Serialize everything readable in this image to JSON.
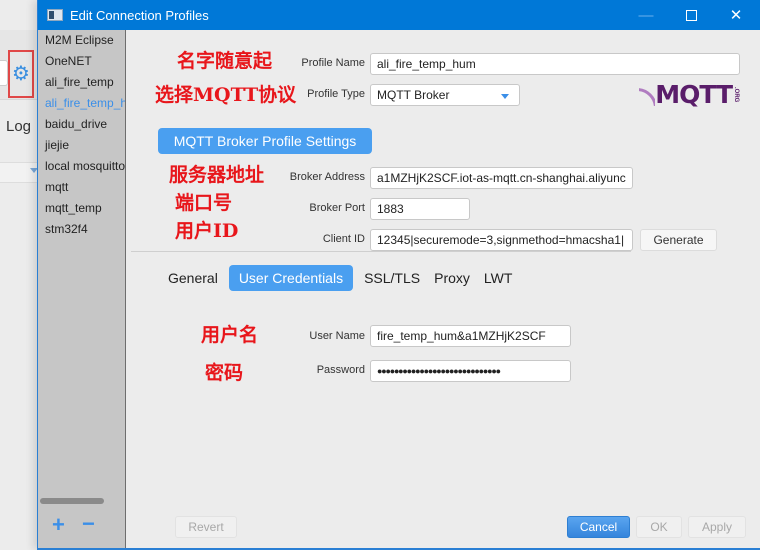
{
  "background": {
    "log_label": "Log"
  },
  "window": {
    "title": "Edit Connection Profiles",
    "minimize": "—",
    "close": "✕"
  },
  "sidebar": {
    "items": [
      {
        "label": "M2M Eclipse",
        "active": false
      },
      {
        "label": "OneNET",
        "active": false
      },
      {
        "label": "ali_fire_temp",
        "active": false
      },
      {
        "label": "ali_fire_temp_hum",
        "active": true
      },
      {
        "label": "baidu_drive",
        "active": false
      },
      {
        "label": "jiejie",
        "active": false
      },
      {
        "label": "local mosquitto",
        "active": false
      },
      {
        "label": "mqtt",
        "active": false
      },
      {
        "label": "mqtt_temp",
        "active": false
      },
      {
        "label": "stm32f4",
        "active": false
      }
    ],
    "add_label": "+",
    "remove_label": "−"
  },
  "annotations": {
    "name": "名字随意起",
    "protocol": "选择MQTT协议",
    "address": "服务器地址",
    "port": "端口号",
    "client_id": "用户ID",
    "username": "用户名",
    "password": "密码"
  },
  "profile": {
    "name_label": "Profile Name",
    "name_value": "ali_fire_temp_hum",
    "type_label": "Profile Type",
    "type_value": "MQTT Broker",
    "logo_text": "MQTT",
    "logo_org": ".ORG"
  },
  "broker": {
    "section_title": "MQTT Broker Profile Settings",
    "address_label": "Broker Address",
    "address_value": "a1MZHjK2SCF.iot-as-mqtt.cn-shanghai.aliyunc",
    "port_label": "Broker Port",
    "port_value": "1883",
    "client_id_label": "Client ID",
    "client_id_value": "12345|securemode=3,signmethod=hmacsha1|",
    "generate_label": "Generate"
  },
  "tabs": [
    {
      "label": "General",
      "active": false
    },
    {
      "label": "User Credentials",
      "active": true
    },
    {
      "label": "SSL/TLS",
      "active": false
    },
    {
      "label": "Proxy",
      "active": false
    },
    {
      "label": "LWT",
      "active": false
    }
  ],
  "credentials": {
    "username_label": "User Name",
    "username_value": "fire_temp_hum&a1MZHjK2SCF",
    "password_label": "Password",
    "password_value": "●●●●●●●●●●●●●●●●●●●●●●●●●●●●●"
  },
  "footer": {
    "revert": "Revert",
    "cancel": "Cancel",
    "ok": "OK",
    "apply": "Apply"
  }
}
